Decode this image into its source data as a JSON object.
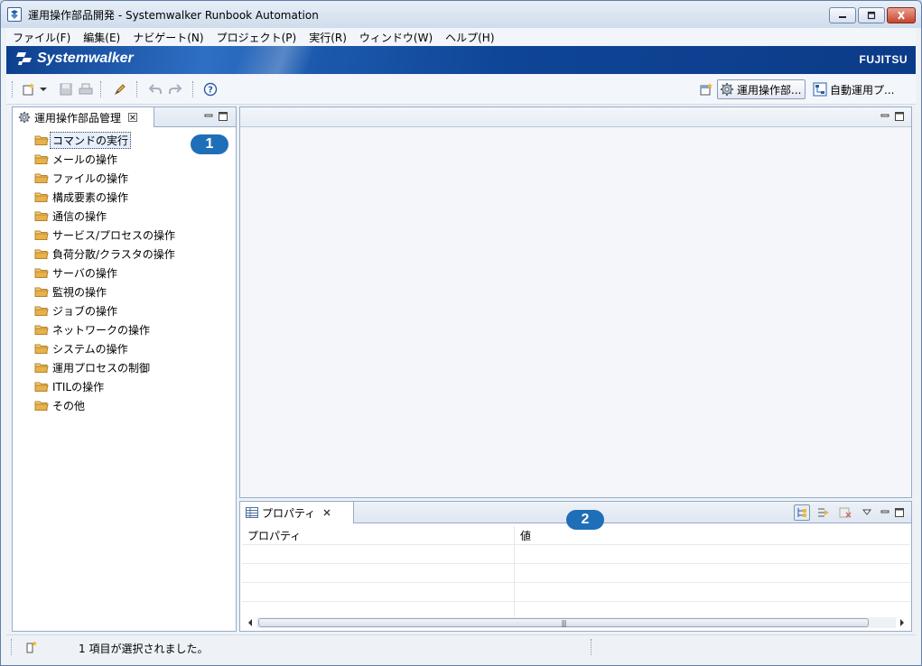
{
  "window": {
    "title": "運用操作部品開発 - Systemwalker Runbook Automation"
  },
  "menu": [
    {
      "label": "ファイル(F)"
    },
    {
      "label": "編集(E)"
    },
    {
      "label": "ナビゲート(N)"
    },
    {
      "label": "プロジェクト(P)"
    },
    {
      "label": "実行(R)"
    },
    {
      "label": "ウィンドウ(W)"
    },
    {
      "label": "ヘルプ(H)"
    }
  ],
  "banner": {
    "product_logo": "Systemwalker",
    "vendor_logo": "FUJITSU"
  },
  "toolbar": {
    "perspectives": [
      {
        "label": "運用操作部...",
        "active": true
      },
      {
        "label": "自動運用プ...",
        "active": false
      }
    ]
  },
  "left_view": {
    "tab_label": "運用操作部品管理",
    "callout": "1",
    "items": [
      {
        "label": "コマンドの実行",
        "selected": true
      },
      {
        "label": "メールの操作"
      },
      {
        "label": "ファイルの操作"
      },
      {
        "label": "構成要素の操作"
      },
      {
        "label": "通信の操作"
      },
      {
        "label": "サービス/プロセスの操作"
      },
      {
        "label": "負荷分散/クラスタの操作"
      },
      {
        "label": "サーバの操作"
      },
      {
        "label": "監視の操作"
      },
      {
        "label": "ジョブの操作"
      },
      {
        "label": "ネットワークの操作"
      },
      {
        "label": "システムの操作"
      },
      {
        "label": "運用プロセスの制御"
      },
      {
        "label": "ITILの操作"
      },
      {
        "label": "その他"
      }
    ]
  },
  "properties_view": {
    "tab_label": "プロパティ",
    "callout": "2",
    "columns": [
      "プロパティ",
      "値"
    ]
  },
  "status": {
    "message": "1 項目が選択されました。"
  },
  "colors": {
    "banner": "#0d3f8d",
    "callout": "#1f6fb8",
    "folder": "#e8b24a"
  }
}
